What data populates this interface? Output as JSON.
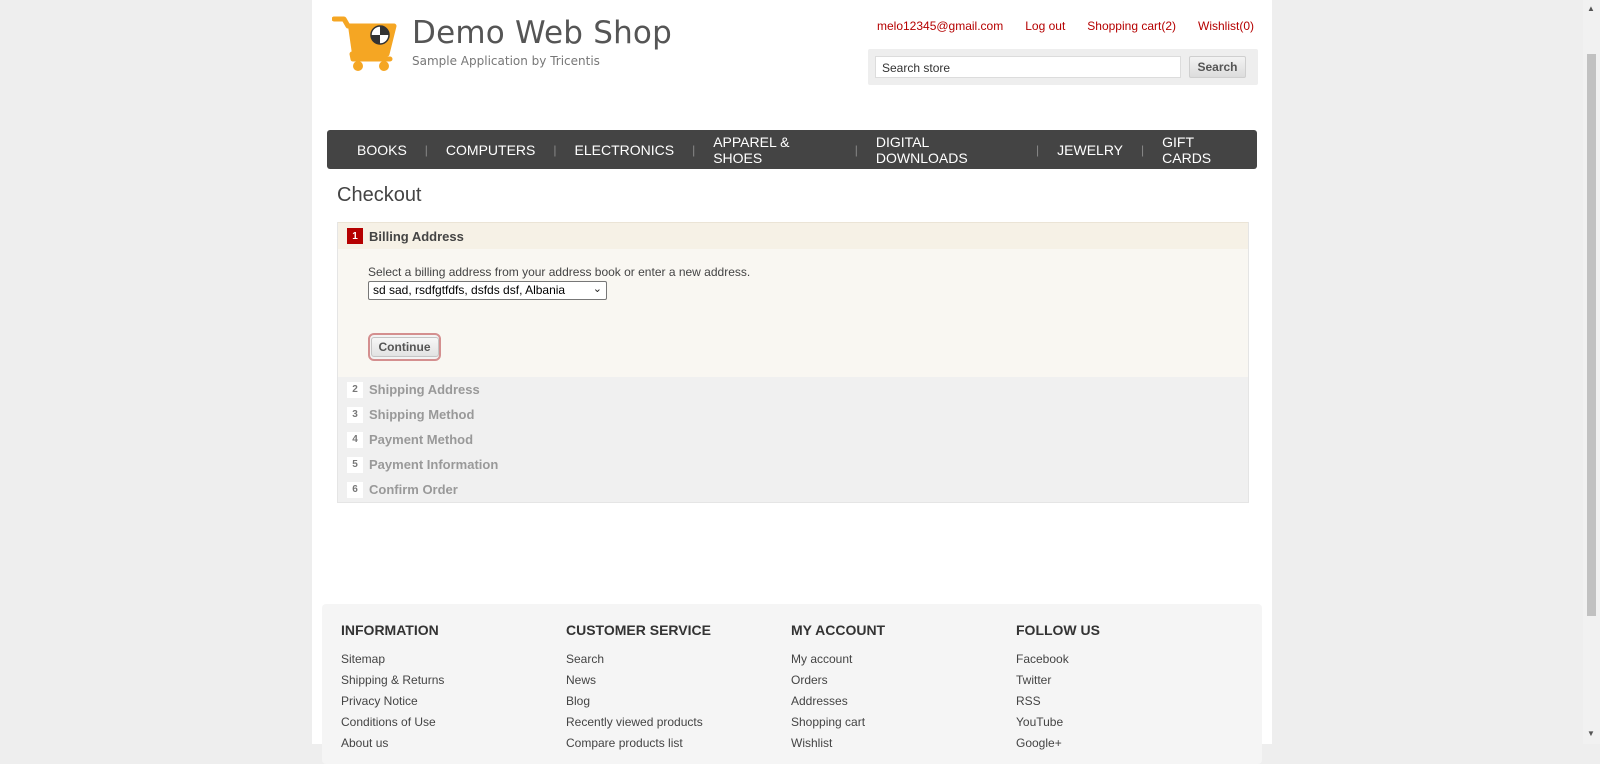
{
  "header": {
    "logo_title": "Demo Web Shop",
    "logo_subtitle": "Sample Application by Tricentis",
    "account_email": "melo12345@gmail.com",
    "logout": "Log out",
    "cart": "Shopping cart(2)",
    "wishlist": "Wishlist(0)",
    "search_value": "Search store",
    "search_button": "Search",
    "accent_color": "#b50000"
  },
  "nav": {
    "items": [
      "BOOKS",
      "COMPUTERS",
      "ELECTRONICS",
      "APPAREL & SHOES",
      "DIGITAL DOWNLOADS",
      "JEWELRY",
      "GIFT CARDS"
    ]
  },
  "checkout": {
    "title": "Checkout",
    "steps": [
      {
        "num": "1",
        "label": "Billing Address"
      },
      {
        "num": "2",
        "label": "Shipping Address"
      },
      {
        "num": "3",
        "label": "Shipping Method"
      },
      {
        "num": "4",
        "label": "Payment Method"
      },
      {
        "num": "5",
        "label": "Payment Information"
      },
      {
        "num": "6",
        "label": "Confirm Order"
      }
    ],
    "billing_hint": "Select a billing address from your address book or enter a new address.",
    "selected_address": "sd sad, rsdfgtfdfs, dsfds dsf, Albania",
    "continue_label": "Continue"
  },
  "footer": {
    "columns": [
      {
        "title": "INFORMATION",
        "links": [
          "Sitemap",
          "Shipping & Returns",
          "Privacy Notice",
          "Conditions of Use",
          "About us"
        ]
      },
      {
        "title": "CUSTOMER SERVICE",
        "links": [
          "Search",
          "News",
          "Blog",
          "Recently viewed products",
          "Compare products list"
        ]
      },
      {
        "title": "MY ACCOUNT",
        "links": [
          "My account",
          "Orders",
          "Addresses",
          "Shopping cart",
          "Wishlist"
        ]
      },
      {
        "title": "FOLLOW US",
        "links": [
          "Facebook",
          "Twitter",
          "RSS",
          "YouTube",
          "Google+"
        ]
      }
    ]
  }
}
